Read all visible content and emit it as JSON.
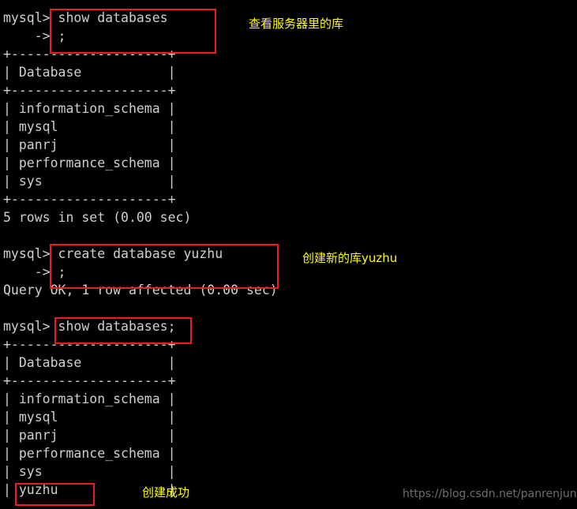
{
  "terminal": {
    "background_color": "#000000",
    "text_color": "#cfcfcf",
    "lines": [
      {
        "id": "l01",
        "text": "mysql> show databases"
      },
      {
        "id": "l02",
        "text": "    -> ;"
      },
      {
        "id": "l03",
        "text": "+--------------------+"
      },
      {
        "id": "l04",
        "text": "| Database           |"
      },
      {
        "id": "l05",
        "text": "+--------------------+"
      },
      {
        "id": "l06",
        "text": "| information_schema |"
      },
      {
        "id": "l07",
        "text": "| mysql              |"
      },
      {
        "id": "l08",
        "text": "| panrj              |"
      },
      {
        "id": "l09",
        "text": "| performance_schema |"
      },
      {
        "id": "l10",
        "text": "| sys                |"
      },
      {
        "id": "l11",
        "text": "+--------------------+"
      },
      {
        "id": "l12",
        "text": "5 rows in set (0.00 sec)"
      },
      {
        "id": "l13",
        "text": ""
      },
      {
        "id": "l14",
        "text": "mysql> create database yuzhu"
      },
      {
        "id": "l15",
        "text": "    -> ;"
      },
      {
        "id": "l16",
        "text": "Query OK, 1 row affected (0.00 sec)"
      },
      {
        "id": "l17",
        "text": ""
      },
      {
        "id": "l18",
        "text": "mysql> show databases;"
      },
      {
        "id": "l19",
        "text": "+--------------------+"
      },
      {
        "id": "l20",
        "text": "| Database           |"
      },
      {
        "id": "l21",
        "text": "+--------------------+"
      },
      {
        "id": "l22",
        "text": "| information_schema |"
      },
      {
        "id": "l23",
        "text": "| mysql              |"
      },
      {
        "id": "l24",
        "text": "| panrj              |"
      },
      {
        "id": "l25",
        "text": "| performance_schema |"
      },
      {
        "id": "l26",
        "text": "| sys                |"
      },
      {
        "id": "l27",
        "text": "| yuzhu              |"
      }
    ]
  },
  "highlights": {
    "color": "#ee1c1c",
    "boxes": [
      {
        "id": "hl-show-databases-1",
        "label": "show databases ;"
      },
      {
        "id": "hl-create-database",
        "label": "create database yuzhu ;"
      },
      {
        "id": "hl-show-databases-2",
        "label": "show databases;"
      },
      {
        "id": "hl-yuzhu-row",
        "label": "yuzhu"
      }
    ]
  },
  "annotations": {
    "color": "#ffff00",
    "items": [
      {
        "id": "ann-view-databases",
        "text": "查看服务器里的库"
      },
      {
        "id": "ann-create-database",
        "text": "创建新的库yuzhu"
      },
      {
        "id": "ann-create-success",
        "text": "创建成功"
      }
    ]
  },
  "watermark": {
    "text": "https://blog.csdn.net/panrenjun",
    "color": "#6e6e6e"
  }
}
